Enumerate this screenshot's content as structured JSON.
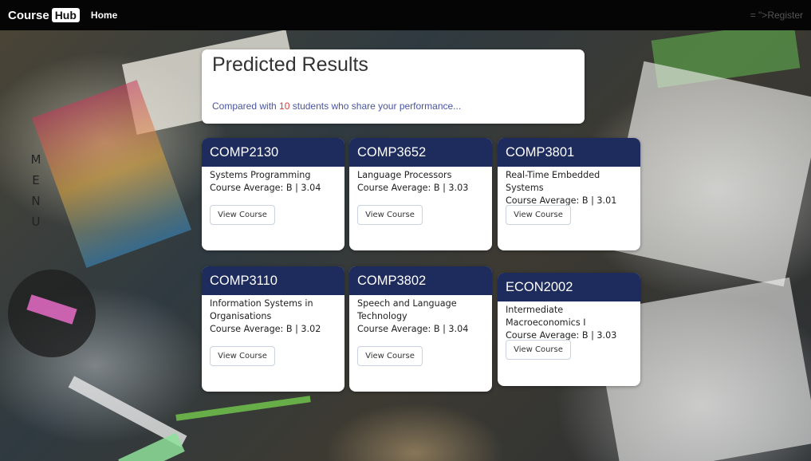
{
  "nav": {
    "brand_course": "Course",
    "brand_hub": "Hub",
    "home": "Home",
    "register": "= \">Register"
  },
  "side_menu": [
    "M",
    "E",
    "N",
    "U"
  ],
  "header": {
    "title": "Predicted Results",
    "subtitle_prefix": "Compared with ",
    "student_count": "10",
    "subtitle_suffix": " students who share your performance..."
  },
  "courses": [
    {
      "code": "COMP2130",
      "name": "Systems Programming",
      "average": "Course Average: B | 3.04",
      "button": "View Course"
    },
    {
      "code": "COMP3652",
      "name": "Language Processors",
      "average": "Course Average: B | 3.03",
      "button": "View Course"
    },
    {
      "code": "COMP3801",
      "name": "Real-Time Embedded Systems",
      "average": "Course Average: B | 3.01",
      "button": "View Course"
    },
    {
      "code": "COMP3110",
      "name": "Information Systems in Organisations",
      "average": "Course Average: B | 3.02",
      "button": "View Course"
    },
    {
      "code": "COMP3802",
      "name": "Speech and Language Technology",
      "average": "Course Average: B | 3.04",
      "button": "View Course"
    },
    {
      "code": "ECON2002",
      "name": "Intermediate Macroeconomics I",
      "average": "Course Average: B | 3.03",
      "button": "View Course"
    }
  ],
  "colors": {
    "navbar": "#050505",
    "card_header": "#1e2b5d",
    "subtitle_text": "#4a55a2",
    "count_highlight": "#e03a3a"
  }
}
